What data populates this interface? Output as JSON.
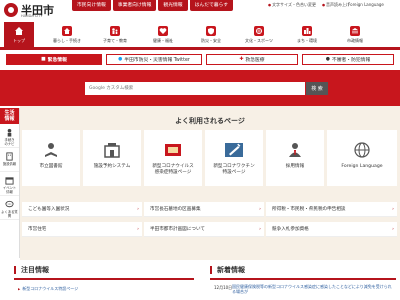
{
  "header": {
    "logo_text": "半田市",
    "logo_sub": "HANDA CITY",
    "audience_tabs": [
      {
        "label": "市民向け情報"
      },
      {
        "label": "事業者向け情報"
      },
      {
        "label": "観光情報"
      },
      {
        "label": "はんだで暮らす"
      }
    ],
    "util_links": [
      {
        "label": "文字サイズ・色合い変更"
      },
      {
        "label": "音声読み上げ"
      }
    ],
    "language_label": "Foreign Language"
  },
  "category_nav": [
    {
      "label": "トップ",
      "icon": "home-icon"
    },
    {
      "label": "暮らし・手続き",
      "icon": "house-icon"
    },
    {
      "label": "子育て・教育",
      "icon": "family-icon"
    },
    {
      "label": "健康・福祉",
      "icon": "health-icon"
    },
    {
      "label": "防災・安全",
      "icon": "shield-icon"
    },
    {
      "label": "文化・スポーツ",
      "icon": "culture-icon"
    },
    {
      "label": "まち・環境",
      "icon": "city-icon"
    },
    {
      "label": "市政情報",
      "icon": "government-icon"
    }
  ],
  "emergency": {
    "urgent_label": "緊急情報",
    "twitter_label": "半田市防災・災害情報 Twitter",
    "medical_label": "救急医療",
    "suspicious_label": "不審者・防犯情報"
  },
  "search": {
    "placeholder": "Google カスタム検索",
    "button_label": "検 索"
  },
  "side_panel": {
    "title": "生活\n情報",
    "items": [
      {
        "label": "手続き\nのナビゲーション",
        "icon": "navigator-icon"
      },
      {
        "label": "施設情報",
        "icon": "building-icon"
      },
      {
        "label": "イベント\n情報",
        "icon": "calendar-icon"
      },
      {
        "label": "よくある質問",
        "icon": "chat-icon"
      }
    ]
  },
  "frequent": {
    "title": "よく利用されるページ",
    "tiles": [
      {
        "label": "市立図書館",
        "icon": "library-icon"
      },
      {
        "label": "施設予約システム",
        "icon": "reservation-icon"
      },
      {
        "label": "新型コロナウイルス\n感染症特設ページ",
        "icon": "corona-icon"
      },
      {
        "label": "新型コロナワクチン\n特設ページ",
        "icon": "vaccine-icon"
      },
      {
        "label": "採用情報",
        "icon": "recruit-icon"
      },
      {
        "label": "Foreign Language",
        "icon": "globe-icon"
      }
    ],
    "links": [
      {
        "label": "こども園等入園状況"
      },
      {
        "label": "市営長石墓地の区画募集"
      },
      {
        "label": "所得税・市民税・県民税の申告相談"
      },
      {
        "label": "市営住宅"
      },
      {
        "label": "半田市都市計画図について"
      },
      {
        "label": "競争入札参加資格"
      }
    ]
  },
  "notice": {
    "title": "注目情報",
    "items": [
      {
        "label": "新型コロナウイルス特設ページ"
      }
    ]
  },
  "news": {
    "title": "新着情報",
    "items": [
      {
        "date": "12月10日",
        "text": "国民健康保険税等の新型コロナウイルス感染症に感染したことなどにより減免を受けられる場合が"
      }
    ]
  },
  "colors": {
    "brand_red": "#c8161d",
    "frequent_bg": "#f7f0e6"
  }
}
